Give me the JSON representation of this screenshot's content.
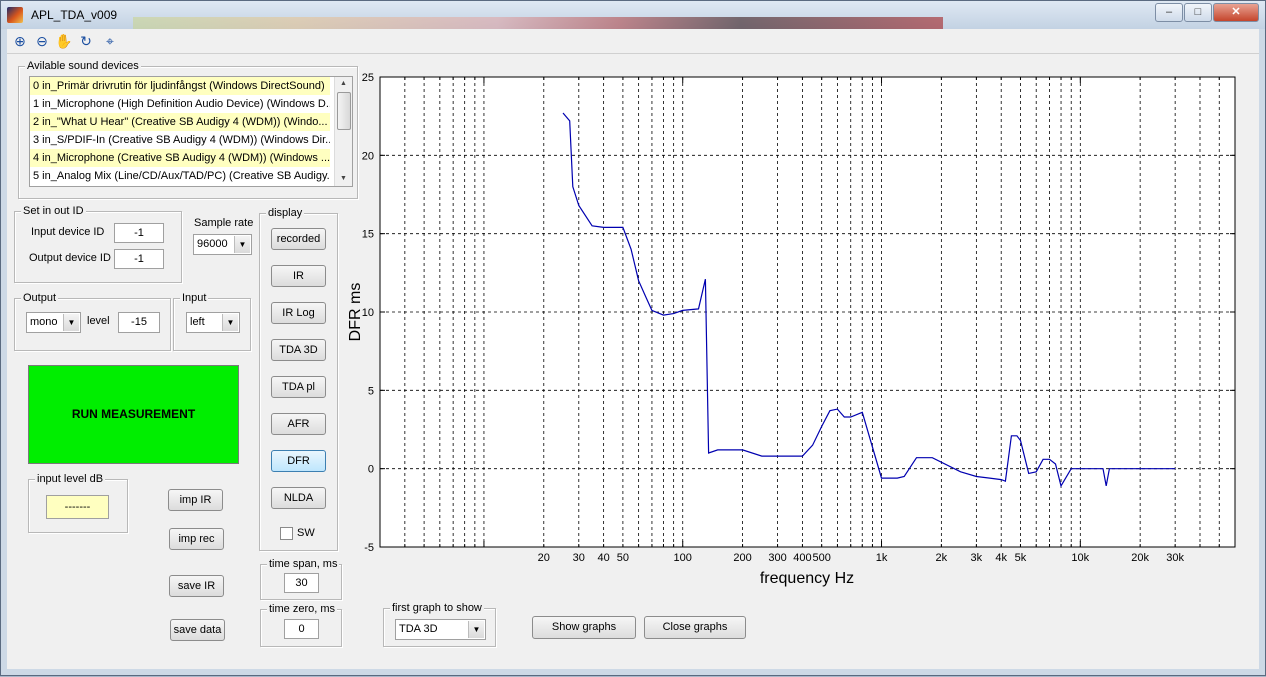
{
  "window": {
    "title": "APL_TDA_v009",
    "min": "–",
    "max": "□",
    "close": "✕"
  },
  "toolbar": {
    "icons": [
      "zoom-in-icon",
      "zoom-out-icon",
      "pan-icon",
      "rotate-icon",
      "data-cursor-icon"
    ]
  },
  "devices": {
    "title": "Avilable sound devices",
    "items": [
      "0 in_Primär drivrutin för ljudinfångst (Windows DirectSound)",
      "1 in_Microphone (High Definition Audio Device) (Windows D...",
      "2 in_\"What U Hear\" (Creative SB Audigy 4 (WDM)) (Windo...",
      "3 in_S/PDIF-In (Creative SB Audigy 4 (WDM)) (Windows Dir...",
      "4 in_Microphone (Creative SB Audigy 4 (WDM)) (Windows ...",
      "5 in_Analog Mix (Line/CD/Aux/TAD/PC) (Creative SB Audigy..."
    ],
    "highlighted": [
      0,
      2,
      4
    ]
  },
  "io": {
    "title": "Set in out ID",
    "input_label": "Input device ID",
    "input_value": "-1",
    "output_label": "Output device ID",
    "output_value": "-1"
  },
  "samplerate": {
    "label": "Sample rate",
    "value": "96000"
  },
  "output": {
    "title": "Output",
    "channel": "mono",
    "level_label": "level",
    "level_value": "-15"
  },
  "input": {
    "title": "Input",
    "channel": "left"
  },
  "run_label": "RUN MEASUREMENT",
  "input_level": {
    "title": "input level dB",
    "value": "-------"
  },
  "buttons": {
    "imp_ir": "imp IR",
    "imp_rec": "imp rec",
    "save_ir": "save IR",
    "save_data": "save data",
    "show_graphs": "Show graphs",
    "close_graphs": "Close graphs"
  },
  "display": {
    "title": "display",
    "buttons": [
      "recorded",
      "IR",
      "IR Log",
      "TDA 3D",
      "TDA pl",
      "AFR",
      "DFR",
      "NLDA"
    ],
    "selected": "DFR",
    "sw_label": "SW"
  },
  "timespan": {
    "title": "time span, ms",
    "value": "30"
  },
  "timezero": {
    "title": "time zero, ms",
    "value": "0"
  },
  "firstgraph": {
    "title": "first graph to show",
    "value": "TDA 3D"
  },
  "chart_data": {
    "type": "line",
    "title": "",
    "xlabel": "frequency   Hz",
    "ylabel": "DFR ms",
    "xscale": "log",
    "xlim": [
      3,
      60000
    ],
    "ylim": [
      -5,
      25
    ],
    "yticks": [
      -5,
      0,
      5,
      10,
      15,
      20,
      25
    ],
    "xticks": [
      20,
      30,
      40,
      50,
      100,
      200,
      300,
      400,
      500,
      1000,
      2000,
      3000,
      4000,
      5000,
      10000,
      20000,
      30000
    ],
    "xticklabels": [
      "20",
      "30",
      "40",
      "50",
      "100",
      "200",
      "300",
      "400",
      "500",
      "1k",
      "2k",
      "3k",
      "4k",
      "5k",
      "10k",
      "20k",
      "30k"
    ],
    "grid": true,
    "series": [
      {
        "color": "#0000b0",
        "x": [
          25,
          27,
          28,
          30,
          35,
          40,
          50,
          55,
          60,
          65,
          70,
          80,
          90,
          100,
          120,
          130,
          135,
          150,
          200,
          250,
          400,
          450,
          500,
          550,
          600,
          650,
          700,
          800,
          1000,
          1200,
          1300,
          1500,
          1800,
          2500,
          3000,
          3500,
          4000,
          4200,
          4500,
          4800,
          5000,
          5500,
          6000,
          6500,
          7000,
          7500,
          8000,
          9000,
          10000,
          11000,
          13000,
          13500,
          14000,
          15000,
          30000
        ],
        "y": [
          22.7,
          22.2,
          18.0,
          16.8,
          15.5,
          15.4,
          15.4,
          14.0,
          12.0,
          11.0,
          10.1,
          9.8,
          9.9,
          10.1,
          10.2,
          12.1,
          1.0,
          1.2,
          1.2,
          0.8,
          0.8,
          1.5,
          2.7,
          3.7,
          3.8,
          3.3,
          3.3,
          3.6,
          -0.6,
          -0.6,
          -0.5,
          0.7,
          0.7,
          -0.2,
          -0.5,
          -0.6,
          -0.7,
          -0.8,
          2.1,
          2.1,
          1.8,
          -0.3,
          -0.2,
          0.6,
          0.6,
          0.3,
          -1.1,
          0.0,
          0.0,
          0.0,
          0.0,
          -1.1,
          0.0,
          0.0,
          0.0
        ]
      }
    ]
  }
}
